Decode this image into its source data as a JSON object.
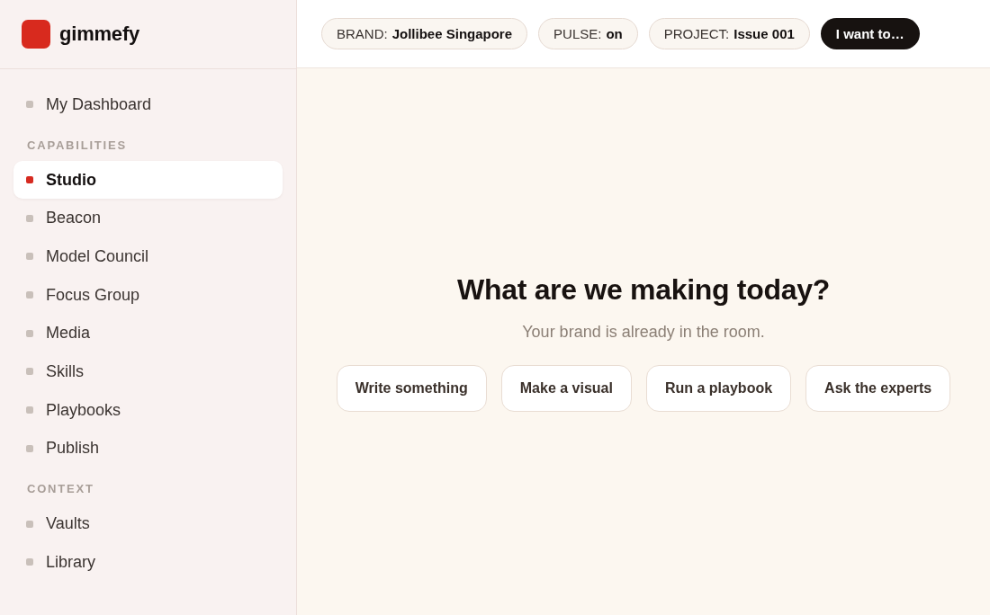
{
  "sidebar": {
    "logo": {
      "text": "gimmefy"
    },
    "nav": [
      {
        "items": [
          {
            "label": "My Dashboard",
            "selected": false
          }
        ]
      },
      {
        "heading": "CAPABILITIES",
        "items": [
          {
            "label": "Studio",
            "selected": true
          },
          {
            "label": "Beacon",
            "selected": false
          },
          {
            "label": "Model Council",
            "selected": false
          },
          {
            "label": "Focus Group",
            "selected": false
          },
          {
            "label": "Media",
            "selected": false
          },
          {
            "label": "Skills",
            "selected": false
          },
          {
            "label": "Playbooks",
            "selected": false
          },
          {
            "label": "Publish",
            "selected": false
          }
        ]
      },
      {
        "heading": "CONTEXT",
        "items": [
          {
            "label": "Vaults",
            "selected": false
          },
          {
            "label": "Library",
            "selected": false
          }
        ]
      }
    ]
  },
  "top_bar": {
    "chips": [
      {
        "label": "BRAND:",
        "value": "Jollibee Singapore"
      },
      {
        "label": "PULSE:",
        "value": "on"
      },
      {
        "label": "PROJECT:",
        "value": "Issue 001"
      }
    ],
    "action_button": "I want to…"
  },
  "main": {
    "heading": "What are we making today?",
    "subheading": "Your brand is already in the room.",
    "quick_actions": [
      "Write something",
      "Make a visual",
      "Run a playbook",
      "Ask the experts"
    ]
  }
}
